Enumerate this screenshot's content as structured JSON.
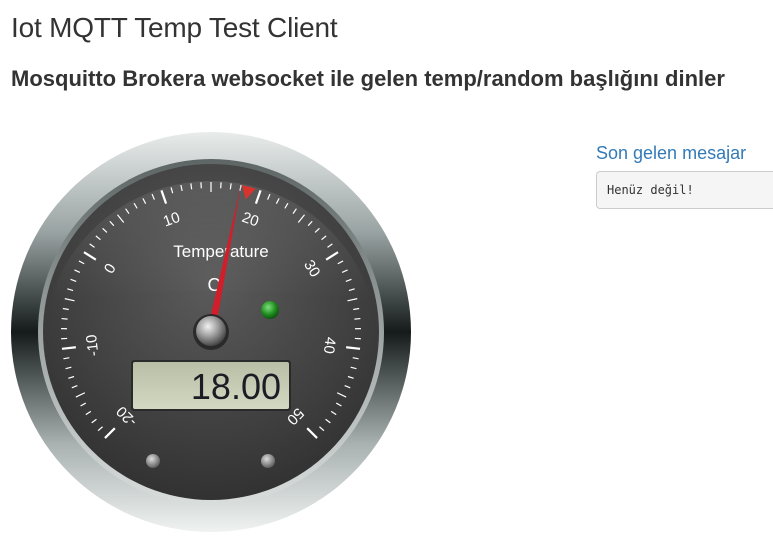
{
  "header": {
    "title": "Iot MQTT Temp Test Client",
    "subtitle": "Mosquitto Brokera websocket ile gelen temp/random başlığını dinler"
  },
  "gauge": {
    "title": "Temperature",
    "unit": "C",
    "value": 18.0,
    "value_display": "18.00",
    "min": -20,
    "max": 50,
    "major_ticks": [
      -20,
      -10,
      0,
      10,
      20,
      30,
      40,
      50
    ],
    "threshold": 20,
    "led_color": "#1d8a1d",
    "needle_color": "#d01f2a",
    "threshold_marker_color": "#d9332b",
    "lcd_color": "#c8ccb4"
  },
  "messages": {
    "title": "Son gelen mesajar",
    "last_message": "Henüz değil!"
  }
}
